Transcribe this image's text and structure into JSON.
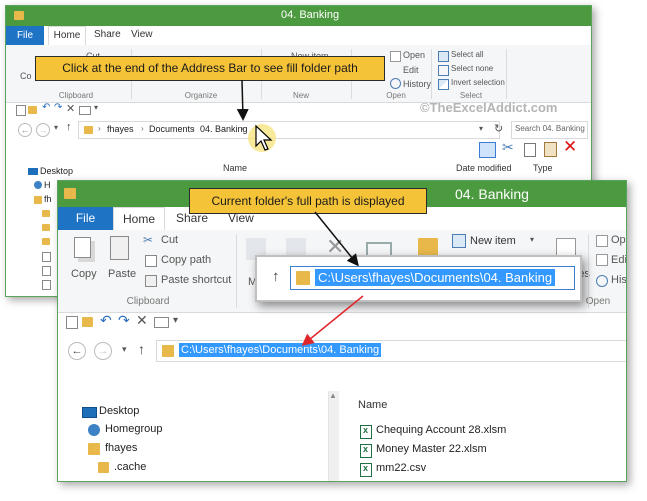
{
  "back_window": {
    "title": "04. Banking",
    "tabs": {
      "file": "File",
      "home": "Home",
      "share": "Share",
      "view": "View"
    },
    "ribbon": {
      "copy": "Co",
      "cut": "Cut",
      "open": "Open",
      "edit": "Edit",
      "history": "History",
      "select_all": "Select all",
      "select_none": "Select none",
      "invert_selection": "Invert selection",
      "new_item": "New item",
      "groups": {
        "clipboard": "Clipboard",
        "organize": "Organize",
        "new": "New",
        "open": "Open",
        "select": "Select"
      }
    },
    "address_crumbs": [
      "fhayes",
      "Documents",
      "04. Banking"
    ],
    "search_placeholder": "Search 04. Banking",
    "columns": {
      "name": "Name",
      "date_modified": "Date modified",
      "type": "Type"
    },
    "tree": [
      "Desktop",
      "H",
      "fh"
    ]
  },
  "watermark": "©TheExcelAddict.com",
  "callout_top": "Click at the end of the Address Bar to see fill folder path",
  "callout_mid": "Current folder's full path is displayed",
  "front_window": {
    "title": "04. Banking",
    "tabs": {
      "file": "File",
      "home": "Home",
      "share": "Share",
      "view": "View"
    },
    "ribbon": {
      "copy": "Copy",
      "paste": "Paste",
      "cut": "Cut",
      "copy_path": "Copy path",
      "paste_shortcut": "Paste shortcut",
      "new_item": "New item",
      "open": "Op",
      "edit": "Edi",
      "history": "His",
      "properties": "erties",
      "m": "M",
      "groups": {
        "clipboard": "Clipboard",
        "open": "Open"
      }
    },
    "zoom_path": "C:\\Users\\fhayes\\Documents\\04. Banking",
    "address_path": "C:\\Users\\fhayes\\Documents\\04. Banking",
    "columns": {
      "name": "Name"
    },
    "tree": [
      "Desktop",
      "Homegroup",
      "fhayes",
      ".cache"
    ],
    "files": [
      "Chequing Account 28.xlsm",
      "Money Master 22.xlsm",
      "mm22.csv"
    ]
  },
  "colors": {
    "title_green": "#4c9a3f",
    "file_tab_blue": "#1f73c5",
    "callout_yellow": "#f5c338",
    "selection_blue": "#3399ff",
    "arrow_red": "#e0262b"
  }
}
